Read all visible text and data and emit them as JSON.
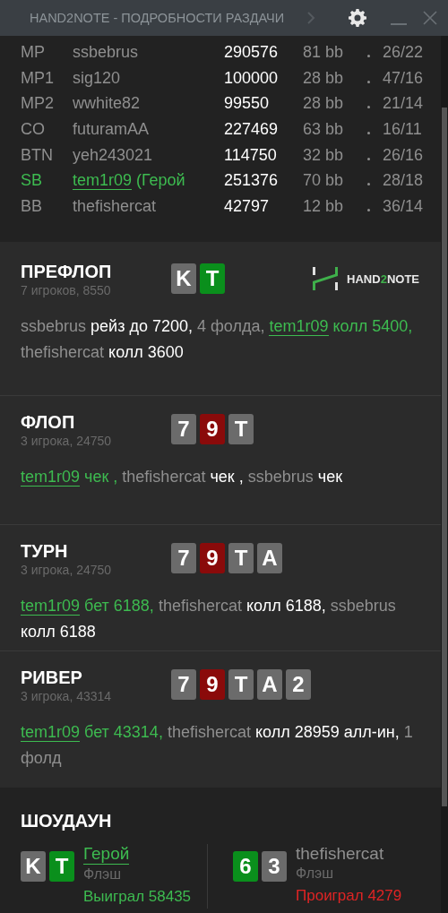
{
  "window": {
    "title": "HAND2NOTE - ПОДРОБНОСТИ РАЗДАЧИ"
  },
  "players": [
    {
      "position": "MP",
      "name": "ssbebrus",
      "stack": "290576",
      "bb": "81 bb",
      "stats": "26/22",
      "hero": false
    },
    {
      "position": "MP1",
      "name": "sig120",
      "stack": "100000",
      "bb": "28 bb",
      "stats": "47/16",
      "hero": false
    },
    {
      "position": "MP2",
      "name": "wwhite82",
      "stack": "99550",
      "bb": "28 bb",
      "stats": "21/14",
      "hero": false
    },
    {
      "position": "CO",
      "name": "futuramAA",
      "stack": "227469",
      "bb": "63 bb",
      "stats": "16/11",
      "hero": false
    },
    {
      "position": "BTN",
      "name": "yeh243021",
      "stack": "114750",
      "bb": "32 bb",
      "stats": "26/16",
      "hero": false
    },
    {
      "position": "SB",
      "name": "tem1r09",
      "tag": "(Герой",
      "stack": "251376",
      "bb": "70 bb",
      "stats": "28/18",
      "hero": true
    },
    {
      "position": "BB",
      "name": "thefishercat",
      "stack": "42797",
      "bb": "12 bb",
      "stats": "36/14",
      "hero": false
    }
  ],
  "logo": {
    "left": "HAND",
    "accent": "2",
    "right": "NOTE"
  },
  "streets": [
    {
      "title": "ПРЕФЛОП",
      "subtitle": "7 игроков, 8550",
      "cards": [
        {
          "rank": "K",
          "color": "#6b6b6b"
        },
        {
          "rank": "T",
          "color": "#0a8f1c"
        }
      ],
      "actions": [
        {
          "text": "ssbebrus",
          "kind": "player"
        },
        {
          "text": "рейз до 7200,",
          "kind": "action"
        },
        {
          "text": "4 фолда,",
          "kind": "info"
        },
        {
          "text": "tem1r09",
          "kind": "hero"
        },
        {
          "text": "колл 5400,",
          "kind": "hero_action"
        },
        {
          "text": "thefishercat",
          "kind": "player"
        },
        {
          "text": "колл 3600",
          "kind": "action"
        }
      ]
    },
    {
      "title": "ФЛОП",
      "subtitle": "3 игрока, 24750",
      "cards": [
        {
          "rank": "7",
          "color": "#6b6b6b"
        },
        {
          "rank": "9",
          "color": "#8a0a0a"
        },
        {
          "rank": "T",
          "color": "#6b6b6b"
        }
      ],
      "actions": [
        {
          "text": "tem1r09",
          "kind": "hero"
        },
        {
          "text": "чек ,",
          "kind": "hero_action"
        },
        {
          "text": "thefishercat",
          "kind": "player"
        },
        {
          "text": "чек ,",
          "kind": "action"
        },
        {
          "text": "ssbebrus",
          "kind": "player"
        },
        {
          "text": "чек",
          "kind": "action"
        }
      ]
    },
    {
      "title": "ТУРН",
      "subtitle": "3 игрока, 24750",
      "cards": [
        {
          "rank": "7",
          "color": "#6b6b6b"
        },
        {
          "rank": "9",
          "color": "#8a0a0a"
        },
        {
          "rank": "T",
          "color": "#6b6b6b"
        },
        {
          "rank": "A",
          "color": "#6b6b6b"
        }
      ],
      "actions": [
        {
          "text": "tem1r09",
          "kind": "hero"
        },
        {
          "text": "бет 6188,",
          "kind": "hero_action"
        },
        {
          "text": "thefishercat",
          "kind": "player"
        },
        {
          "text": "колл 6188,",
          "kind": "action"
        },
        {
          "text": "ssbebrus",
          "kind": "player"
        },
        {
          "text": "колл 6188",
          "kind": "action"
        }
      ]
    },
    {
      "title": "РИВЕР",
      "subtitle": "3 игрока, 43314",
      "cards": [
        {
          "rank": "7",
          "color": "#6b6b6b"
        },
        {
          "rank": "9",
          "color": "#8a0a0a"
        },
        {
          "rank": "T",
          "color": "#6b6b6b"
        },
        {
          "rank": "A",
          "color": "#6b6b6b"
        },
        {
          "rank": "2",
          "color": "#6b6b6b"
        }
      ],
      "actions": [
        {
          "text": "tem1r09",
          "kind": "hero"
        },
        {
          "text": "бет 43314,",
          "kind": "hero_action"
        },
        {
          "text": "thefishercat",
          "kind": "player"
        },
        {
          "text": "колл 28959 алл-ин,",
          "kind": "action"
        },
        {
          "text": "1 фолд",
          "kind": "info"
        }
      ]
    }
  ],
  "showdown": {
    "title": "ШОУДАУН",
    "hands": [
      {
        "cards": [
          {
            "rank": "K",
            "color": "#6b6b6b"
          },
          {
            "rank": "T",
            "color": "#0a8f1c"
          }
        ],
        "name": "Герой",
        "hero": true,
        "hand": "Флэш",
        "result": "Выиграл 58435",
        "won": true
      },
      {
        "cards": [
          {
            "rank": "6",
            "color": "#0a8f1c"
          },
          {
            "rank": "3",
            "color": "#6b6b6b"
          }
        ],
        "name": "thefishercat",
        "hero": false,
        "hand": "Флэш",
        "result": "Проиграл 4279",
        "won": false
      }
    ]
  }
}
